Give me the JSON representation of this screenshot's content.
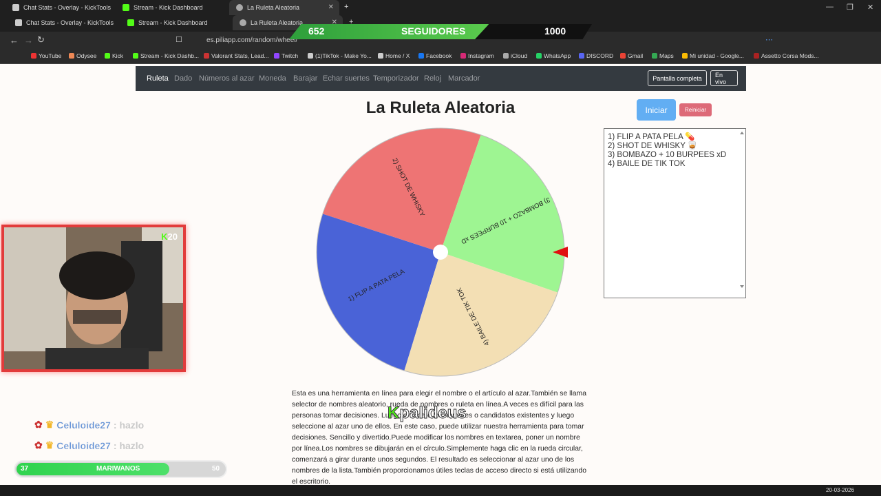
{
  "browser": {
    "tabs_row1": [
      "Chat Stats - Overlay - KickTools",
      "Stream - Kick Dashboard",
      "La Ruleta Aleatoria"
    ],
    "tabs_row2": [
      "Chat Stats - Overlay - KickTools",
      "Stream - Kick Dashboard",
      "La Ruleta Aleatoria"
    ],
    "url": "es.piliapp.com/random/wheel/",
    "bookmarks": [
      "YouTube",
      "Odysee",
      "Kick",
      "Stream - Kick Dashb...",
      "Valorant Stats, Lead...",
      "Twitch",
      "(1)TikTok - Make Yo...",
      "Home / X",
      "Facebook",
      "Instagram",
      "iCloud",
      "WhatsApp",
      "DISCORD",
      "Gmail",
      "Maps",
      "Mi unidad - Google...",
      "Assetto Corsa Mods..."
    ],
    "colors": {
      "chrome": "#1f1f1f",
      "bookmarks": "#2b2b2b"
    }
  },
  "overlay": {
    "followers_current": "652",
    "followers_label": "SEGUIDORES",
    "followers_goal": "1000",
    "kick_badge": "20",
    "watermark": "palideus",
    "chat": [
      {
        "user": "Celuloide27",
        "message": ": hazlo"
      },
      {
        "user": "Celuloide27",
        "message": ": hazlo"
      }
    ],
    "goal": {
      "current": "37",
      "label": "MARIWANOS",
      "target": "50",
      "progress": 0.74
    }
  },
  "site": {
    "nav": [
      "Ruleta",
      "Dado",
      "Números al azar",
      "Moneda",
      "Barajar",
      "Echar suertes",
      "Temporizador",
      "Reloj",
      "Marcador"
    ],
    "fullscreen_label": "Pantalla completa",
    "live_label": "En vivo",
    "title": "La Ruleta Aleatoria",
    "start_label": "Iniciar",
    "reset_label": "Reiniciar",
    "entries": [
      "1) FLIP A PATA PELA 💊",
      "2) SHOT DE WHISKY 🥃",
      "3) BOMBAZO + 10 BURPEES xD",
      "4) BAILE DE TIK TOK"
    ],
    "wheel_labels": [
      "1) FLIP A PATA PELA",
      "2) SHOT DE WHISKY",
      "3) BOMBAZO + 10 BURPEES xD",
      "4) BAILE DE TIK TOK"
    ],
    "wheel_colors": [
      "#4a63d7",
      "#ee7474",
      "#9ef592",
      "#f3dfb4"
    ],
    "description": "Esta es una herramienta en línea para elegir el nombre o el artículo al azar.También se llama selector de nombres aleatorio, rueda de nombres o ruleta en línea.A veces es difícil para las personas tomar decisiones. Luego enumere los nombres o candidatos existentes y luego seleccione al azar uno de ellos. En este caso, puede utilizar nuestra herramienta para tomar decisiones. Sencillo y divertido.Puede modificar los nombres en textarea, poner un nombre por línea.Los nombres se dibujarán en el círculo.Simplemente haga clic en la rueda circular, comenzará a girar durante unos segundos. El resultado es seleccionar al azar uno de los nombres de la lista.También proporcionamos útiles teclas de acceso directo si está utilizando el escritorio."
  },
  "taskbar": {
    "date": "20-03-2026"
  }
}
